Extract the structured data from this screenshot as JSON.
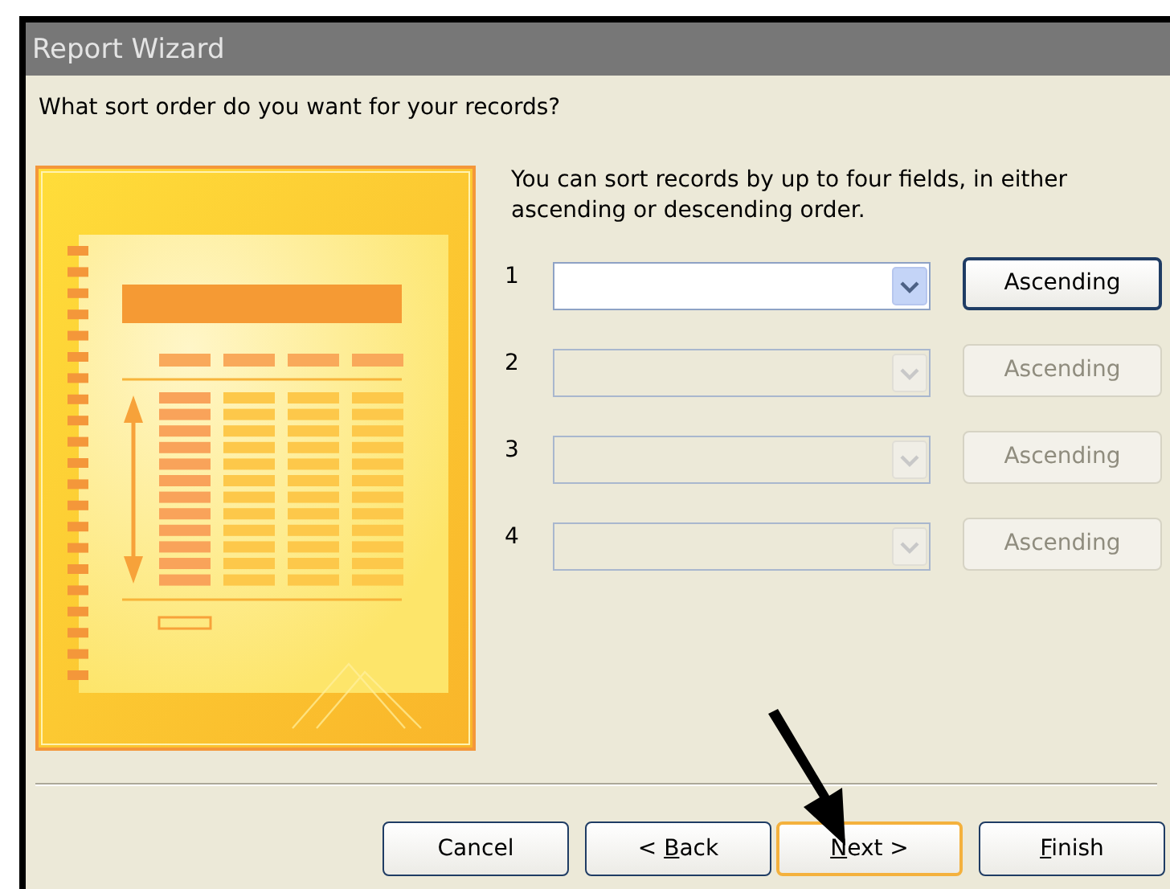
{
  "window": {
    "title": "Report Wizard"
  },
  "question": "What sort order do you want for your records?",
  "description": "You can sort records by up to four fields, in either ascending or descending order.",
  "sort_fields": [
    {
      "number": "1",
      "disabled": false,
      "order": "Ascending"
    },
    {
      "number": "2",
      "disabled": true,
      "order": "Ascending"
    },
    {
      "number": "3",
      "disabled": true,
      "order": "Ascending"
    },
    {
      "number": "4",
      "disabled": true,
      "order": "Ascending"
    }
  ],
  "buttons": [
    {
      "prefix": "Cancel",
      "default": false
    },
    {
      "prefix": "< ",
      "access_key": "B",
      "rest": "ack",
      "default": false
    },
    {
      "access_key": "N",
      "rest": "ext >",
      "default": true
    },
    {
      "access_key": "F",
      "rest": "inish",
      "default": false
    }
  ]
}
